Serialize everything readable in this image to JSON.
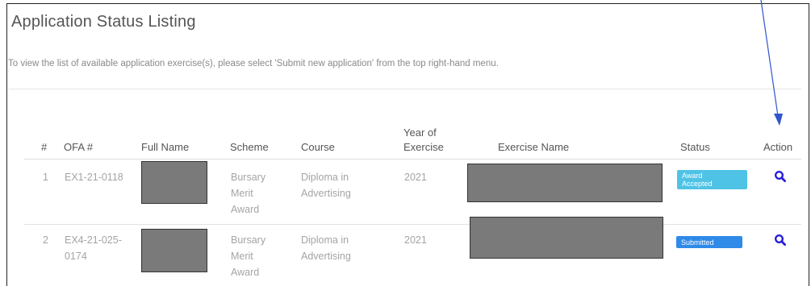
{
  "page": {
    "title": "Application Status Listing",
    "subtitle": "To view the list of available application exercise(s), please select 'Submit new application' from the top right-hand menu."
  },
  "table": {
    "headers": {
      "num": "#",
      "ofa": "OFA #",
      "full_name": "Full Name",
      "scheme": "Scheme",
      "course": "Course",
      "year_line1": "Year of",
      "year_line2": "Exercise",
      "exercise_name": "Exercise Name",
      "status": "Status",
      "action": "Action"
    },
    "rows": [
      {
        "num": "1",
        "ofa_line1": "EX1-21-0118",
        "ofa_line2": "",
        "scheme_line1": "Bursary",
        "scheme_line2": "Merit",
        "scheme_line3": "Award",
        "course_line1": "Diploma in",
        "course_line2": "Advertising",
        "year": "2021",
        "status_line1": "Award",
        "status_line2": "Accepted"
      },
      {
        "num": "2",
        "ofa_line1": "EX4-21-025-",
        "ofa_line2": "0174",
        "scheme_line1": "Bursary",
        "scheme_line2": "Merit",
        "scheme_line3": "Award",
        "course_line1": "Diploma in",
        "course_line2": "Advertising",
        "year": "2021",
        "status_line1": "Submitted",
        "status_line2": ""
      }
    ]
  },
  "colors": {
    "accepted_badge": "#4fc3e6",
    "submitted_badge": "#2f8ae8",
    "action_icon": "#2a1fd8",
    "annotation_arrow": "#2f56c9"
  },
  "icons": {
    "action": "search-icon",
    "annotation": "arrow-annotation"
  }
}
